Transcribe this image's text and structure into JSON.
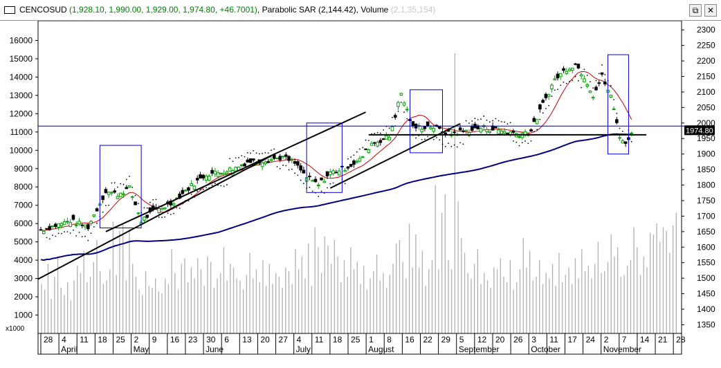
{
  "window": {
    "symbol": "CENCOSUD",
    "ohlc": "(1,928.10, 1,990.00, 1,929.00, 1,974.80, +46.7001)",
    "indicators": "Parabolic SAR (2,144.42), Volume",
    "ghost_text": "(2,1,35,154)",
    "restore_label": "⧉",
    "close_label": "✕"
  },
  "chart_data": {
    "type": "candlestick",
    "symbol": "CENCOSUD",
    "last_price_label": "1974.80",
    "price_axis": {
      "ticks": [
        2300,
        2250,
        2200,
        2150,
        2100,
        2050,
        2000,
        1950,
        1900,
        1850,
        1800,
        1750,
        1700,
        1650,
        1600,
        1550,
        1500,
        1450,
        1400,
        1350
      ],
      "range": [
        1322,
        2325
      ]
    },
    "volume_axis": {
      "ticks": [
        16000,
        15000,
        14000,
        13000,
        12000,
        11000,
        10000,
        9000,
        8000,
        7000,
        6000,
        5000,
        4000,
        3000,
        2000,
        1000
      ],
      "unit_label": "x1000",
      "range": [
        0,
        17000
      ]
    },
    "x_axis": {
      "day_ticks": [
        "28",
        "4",
        "11",
        "18",
        "25",
        "2",
        "9",
        "16",
        "23",
        "30",
        "6",
        "13",
        "20",
        "27",
        "4",
        "11",
        "18",
        "25",
        "1",
        "8",
        "16",
        "22",
        "29",
        "5",
        "12",
        "20",
        "26",
        "3",
        "11",
        "17",
        "24",
        "2",
        "7",
        "14",
        "21",
        "28"
      ],
      "months": [
        "April",
        "May",
        "June",
        "July",
        "August",
        "September",
        "October",
        "November"
      ]
    },
    "price_anchors": [
      {
        "day": 0,
        "close": 1655
      },
      {
        "day": 10,
        "close": 1685
      },
      {
        "day": 16,
        "close": 1665
      },
      {
        "day": 22,
        "close": 1780
      },
      {
        "day": 26,
        "close": 1770
      },
      {
        "day": 30,
        "close": 1790
      },
      {
        "day": 34,
        "close": 1685
      },
      {
        "day": 38,
        "close": 1715
      },
      {
        "day": 44,
        "close": 1740
      },
      {
        "day": 50,
        "close": 1790
      },
      {
        "day": 56,
        "close": 1835
      },
      {
        "day": 60,
        "close": 1840
      },
      {
        "day": 66,
        "close": 1855
      },
      {
        "day": 70,
        "close": 1875
      },
      {
        "day": 76,
        "close": 1880
      },
      {
        "day": 82,
        "close": 1890
      },
      {
        "day": 86,
        "close": 1870
      },
      {
        "day": 90,
        "close": 1825
      },
      {
        "day": 94,
        "close": 1800
      },
      {
        "day": 98,
        "close": 1840
      },
      {
        "day": 103,
        "close": 1855
      },
      {
        "day": 108,
        "close": 1880
      },
      {
        "day": 112,
        "close": 1935
      },
      {
        "day": 118,
        "close": 1955
      },
      {
        "day": 122,
        "close": 2095
      },
      {
        "day": 126,
        "close": 1985
      },
      {
        "day": 132,
        "close": 1990
      },
      {
        "day": 138,
        "close": 1965
      },
      {
        "day": 144,
        "close": 1975
      },
      {
        "day": 150,
        "close": 1985
      },
      {
        "day": 156,
        "close": 1975
      },
      {
        "day": 162,
        "close": 1965
      },
      {
        "day": 166,
        "close": 1975
      },
      {
        "day": 170,
        "close": 2060
      },
      {
        "day": 174,
        "close": 2140
      },
      {
        "day": 178,
        "close": 2175
      },
      {
        "day": 181,
        "close": 2190
      },
      {
        "day": 184,
        "close": 2150
      },
      {
        "day": 187,
        "close": 2090
      },
      {
        "day": 190,
        "close": 2150
      },
      {
        "day": 193,
        "close": 2085
      },
      {
        "day": 196,
        "close": 1960
      },
      {
        "day": 198,
        "close": 1929
      },
      {
        "day": 200,
        "close": 1975
      }
    ],
    "volume_bars_x1000": [
      2700,
      2400,
      3800,
      1900,
      3100,
      4200,
      2500,
      2100,
      2800,
      1800,
      2900,
      3700,
      3300,
      4500,
      2800,
      3100,
      3900,
      5100,
      3400,
      2700,
      2900,
      3500,
      6100,
      3200,
      5600,
      6000,
      2900,
      5700,
      3800,
      3100,
      2400,
      2100,
      3400,
      2600,
      2500,
      3000,
      2300,
      2200,
      3000,
      2700,
      4600,
      3300,
      2400,
      3800,
      4100,
      2800,
      3600,
      3000,
      4100,
      3500,
      2600,
      4200,
      3900,
      2500,
      3000,
      3300,
      4700,
      2900,
      3800,
      3600,
      3000,
      2900,
      2400,
      3200,
      4400,
      3000,
      3500,
      2800,
      4000,
      2600,
      3800,
      2700,
      3300,
      3100,
      2500,
      3600,
      3400,
      2700,
      4600,
      3500,
      4200,
      3000,
      4900,
      2600,
      5800,
      4700,
      3300,
      5300,
      4800,
      3800,
      5100,
      4200,
      2800,
      4000,
      3100,
      4700,
      3500,
      3900,
      2700,
      3700,
      2400,
      3000,
      3400,
      4300,
      2900,
      3300,
      2500,
      3200,
      3800,
      4900,
      5100,
      3900,
      3000,
      6000,
      3600,
      5400,
      3600,
      4500,
      2600,
      3500,
      4000,
      8100,
      3500,
      6600,
      7600,
      4000,
      3500,
      15300,
      7200,
      5200,
      4400,
      3300,
      3000,
      3800,
      4600,
      2700,
      3300,
      2900,
      2500,
      3600,
      3500,
      4100,
      3100,
      2800,
      4000,
      2400,
      2800,
      3500,
      5200,
      3600,
      4500,
      2900,
      3100,
      4000,
      2700,
      3300,
      3000,
      3800,
      2600,
      4400,
      2800,
      3200,
      3600,
      2700,
      4100,
      3000,
      4600,
      3400,
      3700,
      3000,
      3800,
      5000,
      3300,
      3400,
      3900,
      5400,
      4200,
      4700,
      3100,
      3200,
      3700,
      4000,
      5800,
      4700,
      3200,
      4200,
      3600,
      5500,
      5400,
      6000,
      5000,
      5800,
      5600,
      4400,
      5900,
      6600
    ],
    "series": [
      {
        "name": "Price",
        "style": "candlestick"
      },
      {
        "name": "SMA short",
        "color": "#cc0000"
      },
      {
        "name": "SMA long",
        "color": "#000080"
      },
      {
        "name": "Parabolic SAR",
        "style": "dots",
        "color": "#000000"
      }
    ],
    "horizontal_line": {
      "value": 1990,
      "color": "#000080"
    },
    "support_line": {
      "value": 1962,
      "color": "#000000"
    },
    "colors": {
      "up_candle": "#00a000",
      "down_candle": "#000000",
      "volume": "#b0b0b0",
      "box": "#0000cc"
    }
  },
  "bottom_controls": [
    "←",
    "→",
    "↑",
    "↓",
    "⊞",
    "⊕",
    "⊖",
    "⊙"
  ]
}
